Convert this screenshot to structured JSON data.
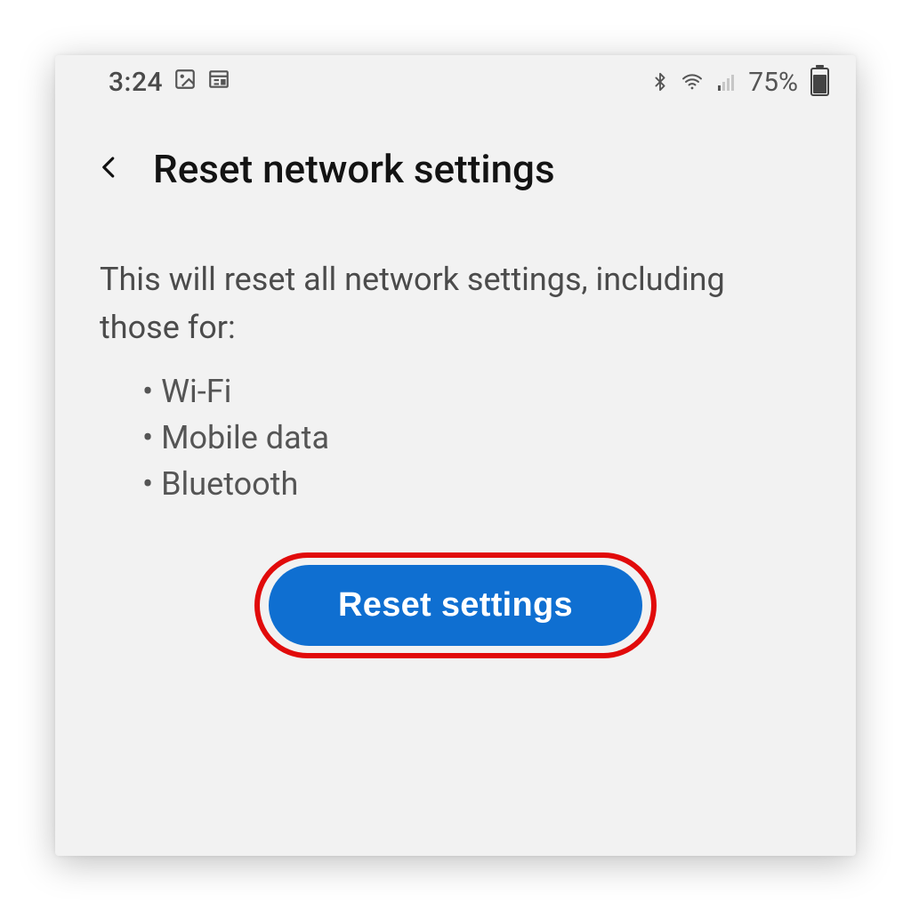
{
  "statusbar": {
    "time": "3:24",
    "battery_pct": "75%"
  },
  "header": {
    "title": "Reset network settings"
  },
  "content": {
    "description": "This will reset all network settings, including those for:",
    "bullets": [
      "Wi-Fi",
      "Mobile data",
      "Bluetooth"
    ]
  },
  "cta": {
    "label": "Reset settings"
  }
}
